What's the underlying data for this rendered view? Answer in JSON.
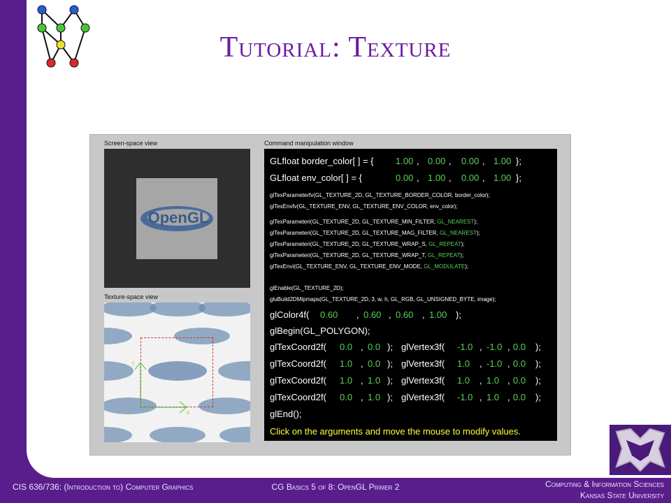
{
  "slide": {
    "title": "Tutorial: Texture",
    "footer_left": "CIS 636/736: (Introduction to) Computer Graphics",
    "footer_center": "CG Basics 5 of 8: OpenGL Primer 2",
    "footer_right_1": "Computing & Information Sciences",
    "footer_right_2": "Kansas State University"
  },
  "screenshot": {
    "screen_view_label": "Screen-space view",
    "texture_view_label": "Texture-space view",
    "command_label": "Command manipulation window",
    "logo_text": "OpenGL",
    "axis_s": "s",
    "axis_t": "t",
    "commands": {
      "border_prefix": "GLfloat border_color[ ] = {",
      "border_vals": [
        "1.00",
        "0.00",
        "0.00",
        "1.00"
      ],
      "env_prefix": "GLfloat env_color[ ] = {",
      "env_vals": [
        "0.00",
        "1.00",
        "0.00",
        "1.00"
      ],
      "close": "};",
      "texparam_fv": "glTexParameterfv(GL_TEXTURE_2D, GL_TEXTURE_BORDER_COLOR, border_color);",
      "texenv_fv": "glTexEnvfv(GL_TEXTURE_ENV, GL_TEXTURE_ENV_COLOR, env_color);",
      "min_filter_prefix": "glTexParameteri(GL_TEXTURE_2D, GL_TEXTURE_MIN_FILTER,",
      "min_filter_val": "GL_NEAREST",
      "mag_filter_prefix": "glTexParameteri(GL_TEXTURE_2D, GL_TEXTURE_MAG_FILTER,",
      "mag_filter_val": "GL_NEAREST",
      "wrap_s_prefix": "glTexParameteri(GL_TEXTURE_2D, GL_TEXTURE_WRAP_S,",
      "wrap_s_val": "GL_REPEAT",
      "wrap_t_prefix": "glTexParameteri(GL_TEXTURE_2D, GL_TEXTURE_WRAP_T,",
      "wrap_t_val": "GL_REPEAT",
      "env_mode_prefix": "glTexEnvi(GL_TEXTURE_ENV, GL_TEXTURE_ENV_MODE,",
      "env_mode_val": "GL_MODULATE",
      "paren_close": ");",
      "enable": "glEnable(GL_TEXTURE_2D);",
      "mipmaps": "gluBuild2DMipmaps(GL_TEXTURE_2D, 3, w, h, GL_RGB, GL_UNSIGNED_BYTE, image);",
      "color_prefix": "glColor4f(",
      "color_vals": [
        "0.60",
        "0.60",
        "0.60",
        "1.00"
      ],
      "begin": "glBegin(GL_POLYGON);",
      "texcoord_prefix": "glTexCoord2f(",
      "vertex_prefix": "glVertex3f(",
      "vertices": [
        {
          "tc": [
            "0.0",
            "0.0"
          ],
          "v": [
            "-1.0",
            "-1.0",
            "0.0"
          ]
        },
        {
          "tc": [
            "1.0",
            "0.0"
          ],
          "v": [
            "1.0",
            "-1.0",
            "0.0"
          ]
        },
        {
          "tc": [
            "1.0",
            "1.0"
          ],
          "v": [
            "1.0",
            "1.0",
            "0.0"
          ]
        },
        {
          "tc": [
            "0.0",
            "1.0"
          ],
          "v": [
            "-1.0",
            "1.0",
            "0.0"
          ]
        }
      ],
      "end": "glEnd();",
      "hint": "Click on the arguments and move the mouse to modify values."
    }
  },
  "colors": {
    "accent": "#6a1aa0",
    "frame": "#5a1e8c",
    "value_green": "#5ad25a",
    "hint_yellow": "#ffff3c"
  }
}
